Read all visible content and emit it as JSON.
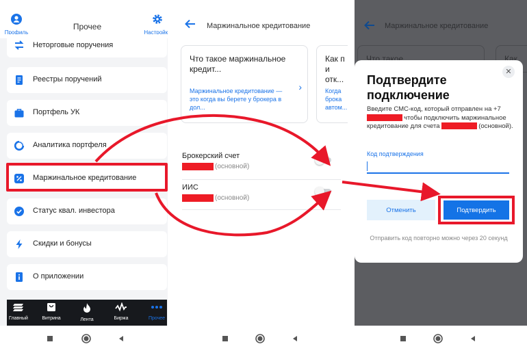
{
  "screen1": {
    "header": {
      "profile_label": "Профиль",
      "title": "Прочее",
      "settings_label": "Настройки"
    },
    "menu": [
      {
        "label": "Неторговые поручения",
        "icon": "transfer-arrows-icon"
      },
      {
        "label": "Реестры поручений",
        "icon": "document-list-icon"
      },
      {
        "label": "Портфель УК",
        "icon": "briefcase-icon"
      },
      {
        "label": "Аналитика портфеля",
        "icon": "pie-chart-icon"
      },
      {
        "label": "Маржинальное кредитование",
        "icon": "percent-icon"
      },
      {
        "label": "Статус квал. инвестора",
        "icon": "check-badge-icon"
      },
      {
        "label": "Скидки и бонусы",
        "icon": "lightning-icon"
      },
      {
        "label": "О приложении",
        "icon": "info-icon"
      }
    ],
    "tabs": [
      {
        "label": "Главный"
      },
      {
        "label": "Витрина"
      },
      {
        "label": "Лента"
      },
      {
        "label": "Биржа"
      },
      {
        "label": "Прочее"
      }
    ]
  },
  "screen2": {
    "title": "Маржинальное кредитование",
    "card1": {
      "title": "Что такое маржинальное кредит...",
      "link": "Маржинальное кредитование — это когда вы берете у брокера в дол..."
    },
    "card2": {
      "title": "Как п и отк...",
      "link": "Когда брока автом..."
    },
    "accounts": [
      {
        "name": "Брокерский счет",
        "suffix": "(основной)"
      },
      {
        "name": "ИИС",
        "suffix": "(основной)"
      }
    ]
  },
  "screen3": {
    "title": "Маржинальное кредитование",
    "card1_title": "Что такое",
    "card2_title": "Как",
    "dialog": {
      "title": "Подтвердите подключение",
      "text_part1": "Введите СМС-код, который отправлен на +7",
      "text_part2": "чтобы подключить маржинальное кредитование для счета",
      "text_part3": "(основной).",
      "input_label": "Код подтверждения",
      "cancel_label": "Отменить",
      "confirm_label": "Подтвердить",
      "resend_text": "Отправить код повторно можно через 20 секунд"
    }
  },
  "colors": {
    "accent": "#1a73e8",
    "annotation_red": "#e8182a",
    "redaction": "#ee1c25",
    "tabbar": "#17191d"
  }
}
